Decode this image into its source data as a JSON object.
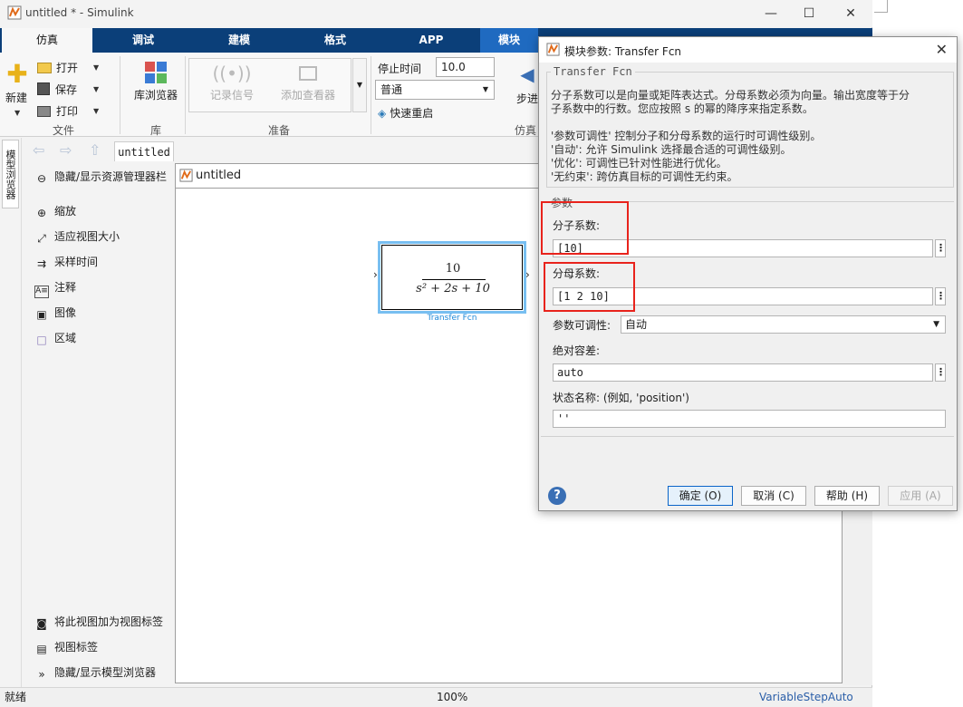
{
  "window": {
    "title": "untitled * - Simulink",
    "minimize": "—",
    "maximize": "☐",
    "close": "✕"
  },
  "tabs": [
    "仿真",
    "调试",
    "建模",
    "格式",
    "APP",
    "模块"
  ],
  "ribbon": {
    "new_label": "新建",
    "open_label": "打开",
    "save_label": "保存",
    "print_label": "打印",
    "file_section": "文件",
    "library_label": "库浏览器",
    "library_section": "库",
    "log_signals": "记录信号",
    "add_viewer": "添加查看器",
    "prepare_section": "准备",
    "stop_time_label": "停止时间",
    "stop_time_value": "10.0",
    "mode_value": "普通",
    "fast_restart": "快速重启",
    "step_label": "步进",
    "sim_section": "仿真"
  },
  "browser": {
    "side_tab": "模型浏览器",
    "crumb_tab": "untitled",
    "items": [
      {
        "icon": "⊖",
        "label": "隐藏/显示资源管理器栏"
      },
      {
        "icon": "⊕",
        "label": "缩放"
      },
      {
        "icon": "⤢",
        "label": "适应视图大小"
      },
      {
        "icon": "⇉",
        "label": "采样时间"
      },
      {
        "icon": "A≡",
        "label": "注释"
      },
      {
        "icon": "▣",
        "label": "图像"
      },
      {
        "icon": "□",
        "label": "区域"
      }
    ],
    "bottom_items": [
      {
        "icon": "◙",
        "label": "将此视图加为视图标签"
      },
      {
        "icon": "▤",
        "label": "视图标签"
      },
      {
        "icon": "»",
        "label": "隐藏/显示模型浏览器"
      }
    ]
  },
  "canvas": {
    "path_label": "untitled",
    "block": {
      "numerator": "10",
      "denominator": "s² + 2s + 10",
      "name": "Transfer Fcn"
    }
  },
  "status": {
    "left": "就绪",
    "zoom": "100%",
    "solver": "VariableStepAuto"
  },
  "dialog": {
    "title": "模块参数: Transfer Fcn",
    "group_title": "Transfer Fcn",
    "desc_lines": [
      "分子系数可以是向量或矩阵表达式。分母系数必须为向量。输出宽度等于分",
      "子系数中的行数。您应按照 s 的幂的降序来指定系数。",
      "",
      "'参数可调性' 控制分子和分母系数的运行时可调性级别。",
      "'自动': 允许 Simulink 选择最合适的可调性级别。",
      "'优化': 可调性已针对性能进行优化。",
      "'无约束': 跨仿真目标的可调性无约束。"
    ],
    "params_title": "参数",
    "numerator_label": "分子系数:",
    "numerator_value": "[10]",
    "denominator_label": "分母系数:",
    "denominator_value": "[1 2 10]",
    "tunability_label": "参数可调性:",
    "tunability_value": "自动",
    "abstol_label": "绝对容差:",
    "abstol_value": "auto",
    "statename_label": "状态名称: (例如, 'position')",
    "statename_value": "''",
    "ok": "确定 (O)",
    "cancel": "取消 (C)",
    "help": "帮助 (H)",
    "apply": "应用 (A)"
  }
}
